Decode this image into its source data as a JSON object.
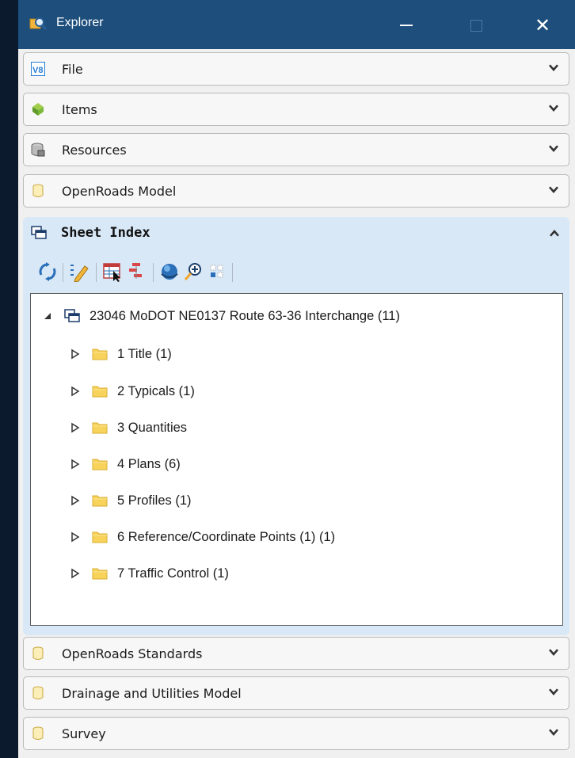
{
  "window": {
    "title": "Explorer",
    "title_bar_color": "#1d4e7c",
    "buttons": [
      "minimize",
      "maximize",
      "close"
    ],
    "close_glyph": "✕"
  },
  "sections_top": [
    {
      "label": "File",
      "icon": "v8-file-icon"
    },
    {
      "label": "Items",
      "icon": "items-gem-icon"
    },
    {
      "label": "Resources",
      "icon": "resources-db-icon"
    },
    {
      "label": "OpenRoads Model",
      "icon": "cylinder-icon"
    }
  ],
  "active_section": {
    "label": "Sheet Index",
    "icon": "sheet-index-icon",
    "toolbar": [
      "refresh-icon",
      "edit-properties-icon",
      "table-select-icon",
      "tree-icon",
      "globe-icon",
      "zoom-icon",
      "grid-icon"
    ],
    "tree": {
      "root": "23046 MoDOT NE0137 Route 63-36 Interchange (11)",
      "children": [
        "1 Title (1)",
        "2 Typicals (1)",
        "3 Quantities",
        "4 Plans (6)",
        "5 Profiles (1)",
        "6 Reference/Coordinate Points (1) (1)",
        "7 Traffic Control (1)"
      ]
    }
  },
  "sections_bottom": [
    {
      "label": "OpenRoads Standards",
      "icon": "cylinder-icon"
    },
    {
      "label": "Drainage and Utilities Model",
      "icon": "cylinder-icon"
    },
    {
      "label": "Survey",
      "icon": "cylinder-icon"
    }
  ],
  "colors": {
    "accent_header": "#d9e8f7",
    "folder": "#f7d35c"
  }
}
